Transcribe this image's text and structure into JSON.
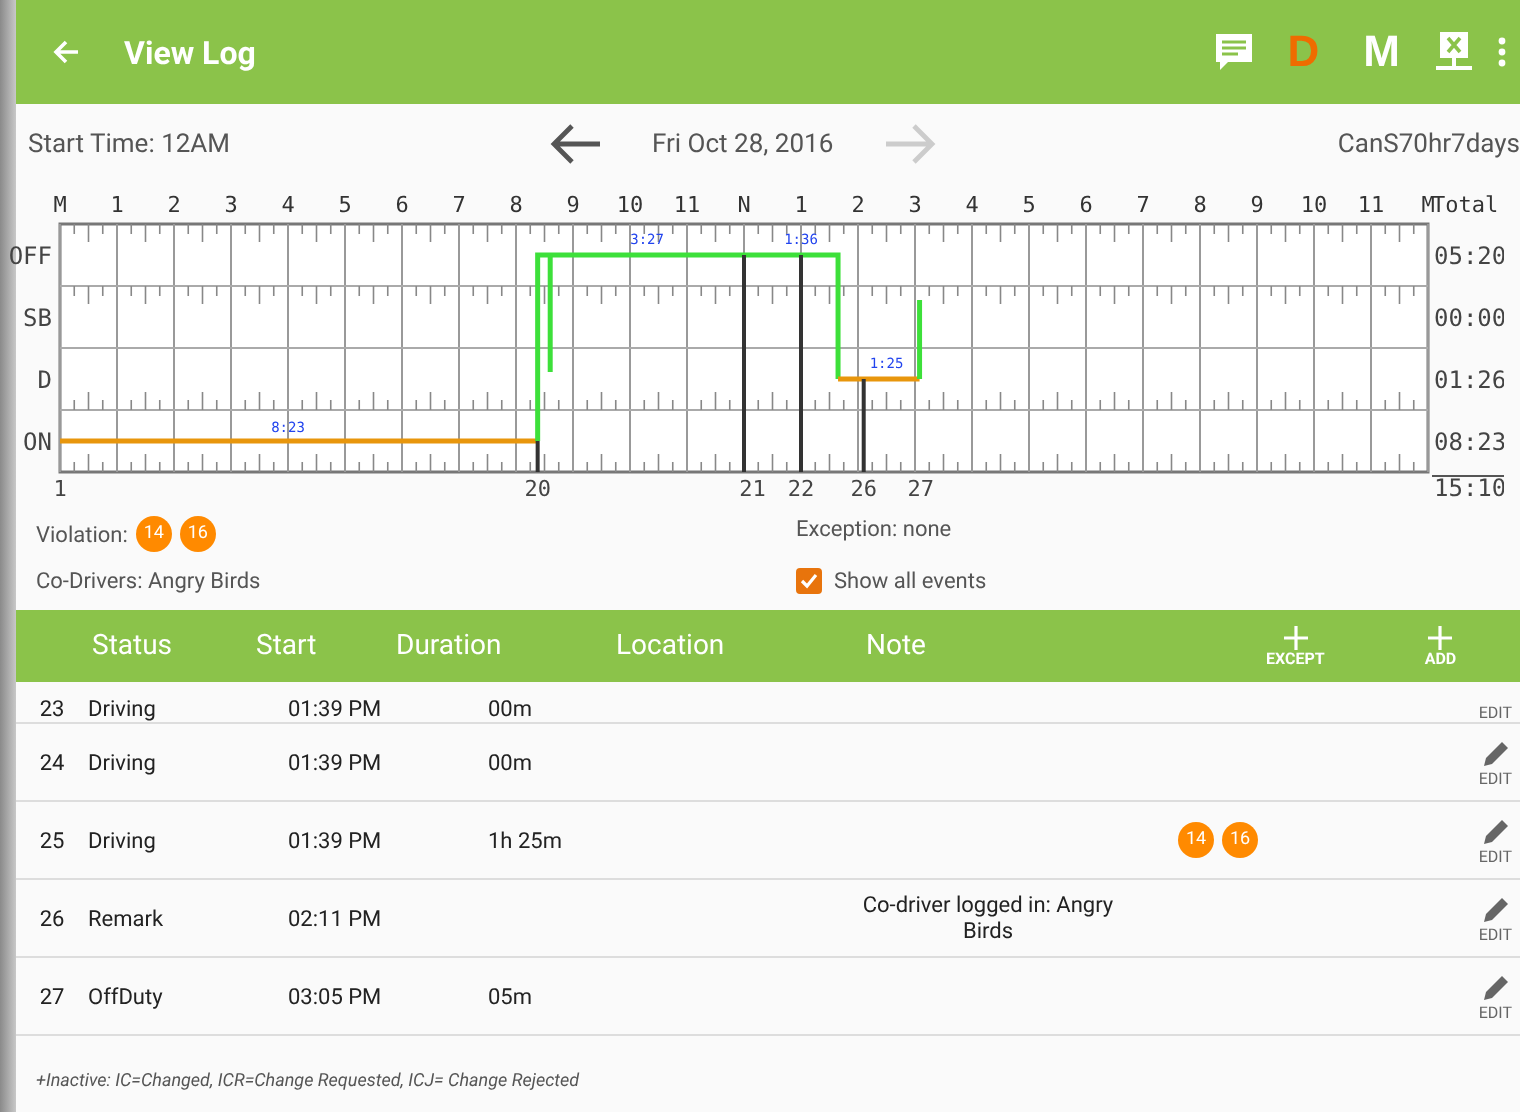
{
  "app_bar": {
    "title": "View Log",
    "status_letters": [
      "D",
      "M"
    ]
  },
  "date_nav": {
    "start_time": "Start Time: 12AM",
    "date": "Fri Oct 28, 2016",
    "prev_disabled": false,
    "next_disabled": true,
    "ruleset": "CanS70hr7days"
  },
  "graph": {
    "hours": [
      "M",
      "1",
      "2",
      "3",
      "4",
      "5",
      "6",
      "7",
      "8",
      "9",
      "10",
      "11",
      "N",
      "1",
      "2",
      "3",
      "4",
      "5",
      "6",
      "7",
      "8",
      "9",
      "10",
      "11",
      "M"
    ],
    "total_header": "Total",
    "rows": [
      {
        "label": "OFF",
        "total": "05:20"
      },
      {
        "label": "SB",
        "total": "00:00"
      },
      {
        "label": "D",
        "total": "01:26"
      },
      {
        "label": "ON",
        "total": "08:23"
      }
    ],
    "grand_total": "15:10",
    "duration_labels": [
      "8:23",
      "3:27",
      "1:36",
      "1:25"
    ],
    "event_markers": [
      "1",
      "20",
      "21",
      "22",
      "26",
      "27"
    ]
  },
  "summary": {
    "violation_label": "Violation:",
    "violations": [
      "14",
      "16"
    ],
    "exception": "Exception: none",
    "co_drivers": "Co-Drivers: Angry Birds",
    "show_all": {
      "label": "Show all events",
      "checked": true
    }
  },
  "table": {
    "columns": [
      "Status",
      "Start",
      "Duration",
      "Location",
      "Note"
    ],
    "actions": [
      "EXCEPT",
      "ADD"
    ],
    "rows": [
      {
        "no": "23",
        "status": "Driving",
        "start": "01:39 PM",
        "duration": "00m",
        "edit": "EDIT"
      },
      {
        "no": "24",
        "status": "Driving",
        "start": "01:39 PM",
        "duration": "00m",
        "edit": "EDIT"
      },
      {
        "no": "25",
        "status": "Driving",
        "start": "01:39 PM",
        "duration": "1h 25m",
        "violations": [
          "14",
          "16"
        ],
        "edit": "EDIT"
      },
      {
        "no": "26",
        "status": "Remark",
        "start": "02:11 PM",
        "note": "Co-driver logged in: Angry Birds",
        "edit": "EDIT"
      },
      {
        "no": "27",
        "status": "OffDuty",
        "start": "03:05 PM",
        "duration": "05m",
        "edit": "EDIT"
      }
    ]
  },
  "footer": "+Inactive: IC=Changed, ICR=Change Requested, ICJ= Change Rejected"
}
